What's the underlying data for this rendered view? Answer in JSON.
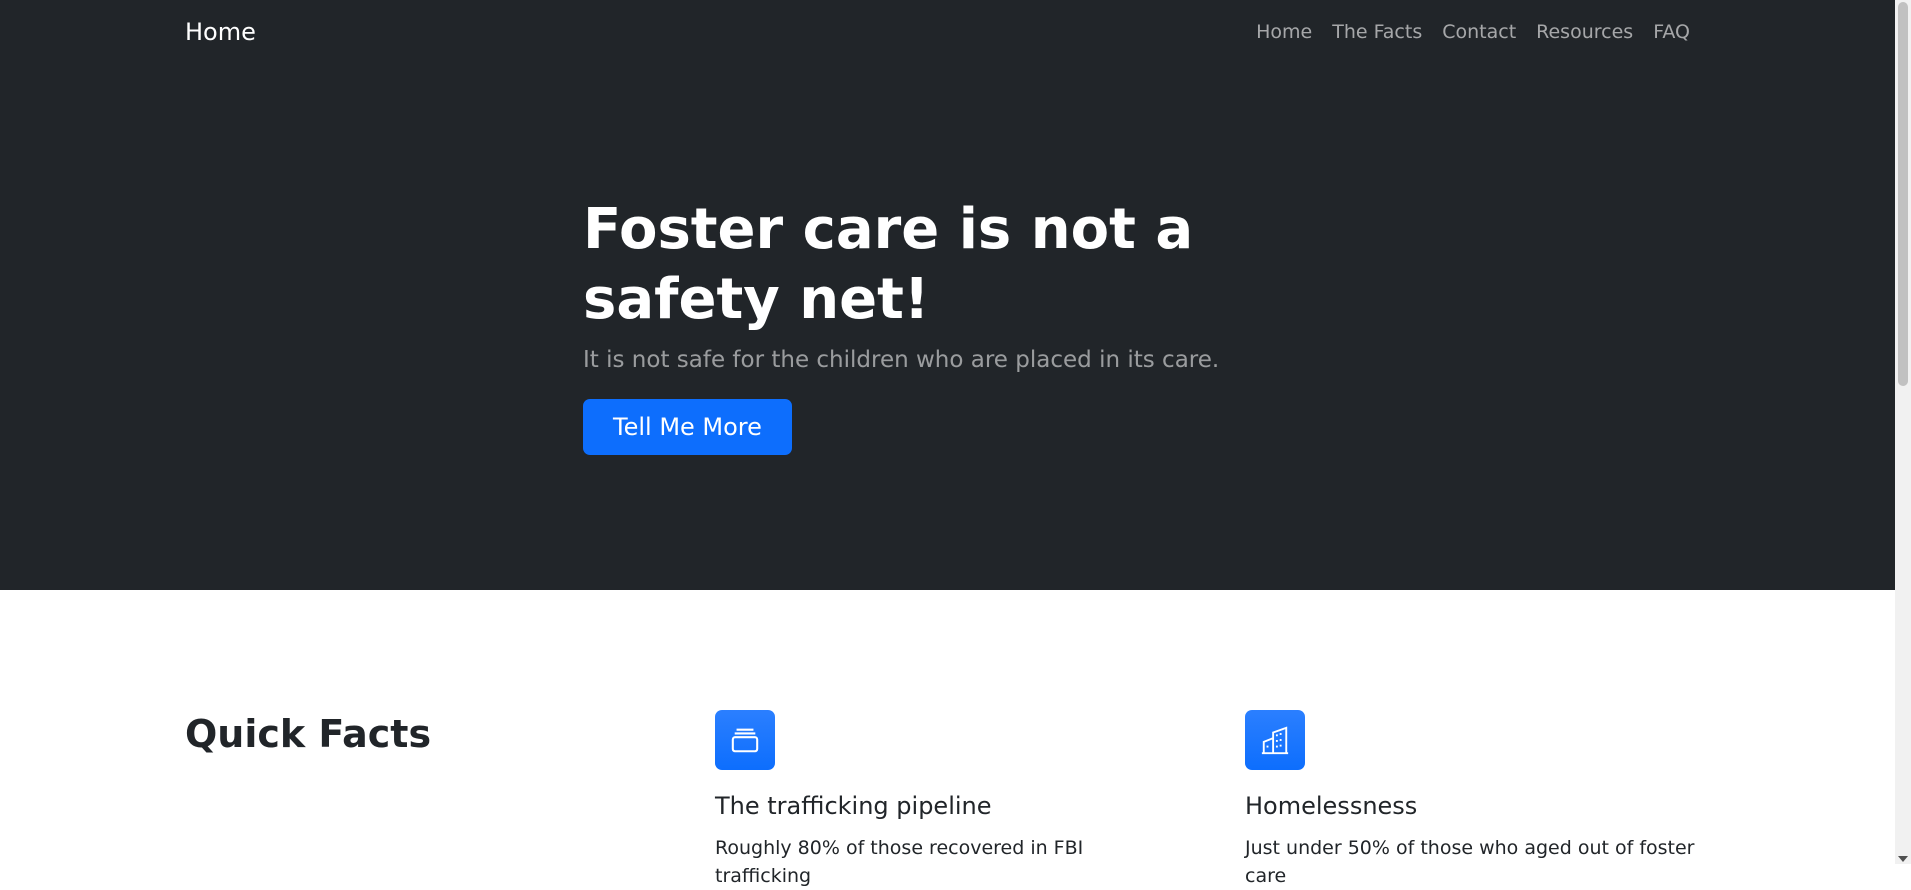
{
  "navbar": {
    "brand": "Home",
    "links": [
      "Home",
      "The Facts",
      "Contact",
      "Resources",
      "FAQ"
    ]
  },
  "hero": {
    "title": "Foster care is not a safety net!",
    "subtitle": "It is not safe for the children who are placed in its care.",
    "button_label": "Tell Me More"
  },
  "quick_facts": {
    "title": "Quick Facts",
    "features": [
      {
        "icon": "collection-icon",
        "title": "The trafficking pipeline",
        "text": "Roughly 80% of those recovered in FBI trafficking"
      },
      {
        "icon": "building-icon",
        "title": "Homelessness",
        "text": "Just under 50% of those who aged out of foster care"
      }
    ]
  },
  "colors": {
    "hero_bg": "#212529",
    "primary": "#0d6efd"
  }
}
